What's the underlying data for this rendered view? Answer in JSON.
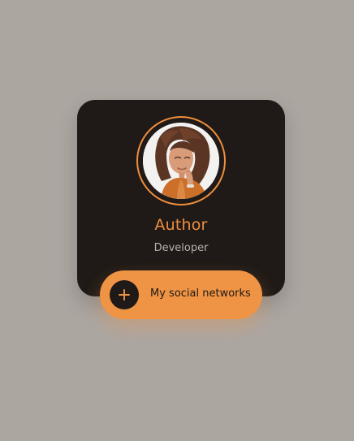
{
  "card": {
    "name": "Author",
    "role": "Developer",
    "social_label": "My social networks",
    "avatar_icon": "person-avatar-photo",
    "action_icon": "plus-icon",
    "colors": {
      "accent": "#ef8e3d",
      "card_bg": "#1f1a17",
      "page_bg": "#aca6a1",
      "button_bg": "#ef9444"
    }
  }
}
